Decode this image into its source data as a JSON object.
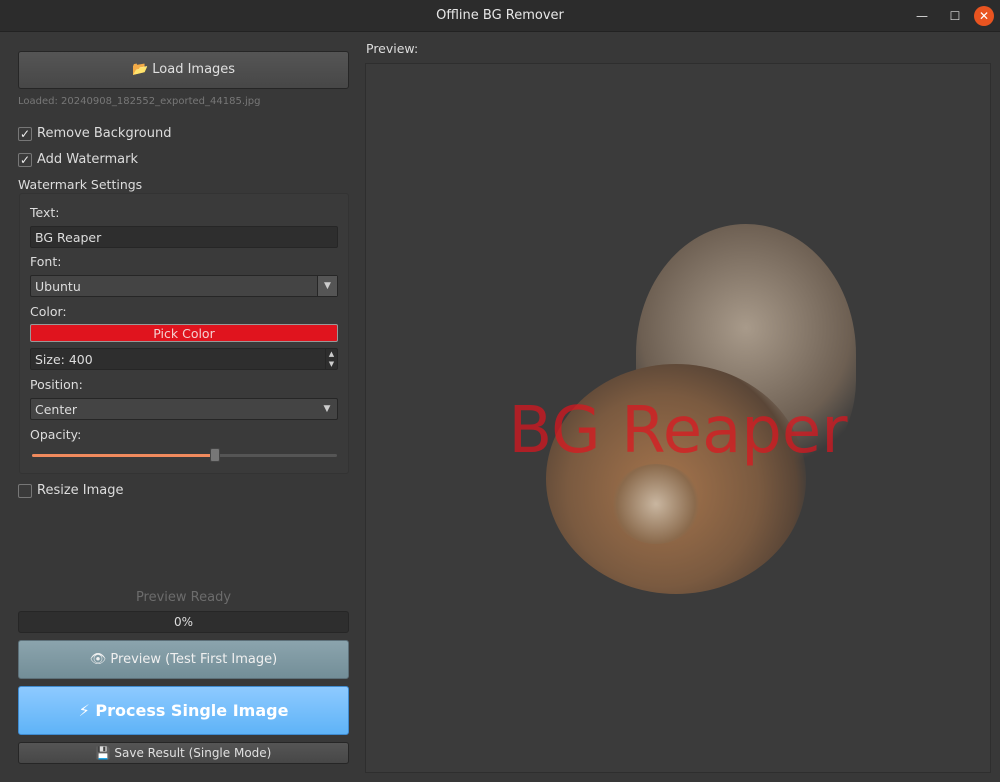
{
  "window": {
    "title": "Offline BG Remover"
  },
  "left": {
    "load_button": "📂 Load Images",
    "loaded_text": "Loaded: 20240908_182552_exported_44185.jpg",
    "remove_bg": {
      "label": "Remove Background",
      "checked": true
    },
    "add_watermark": {
      "label": "Add Watermark",
      "checked": true
    },
    "wm_group_title": "Watermark Settings",
    "text_label": "Text:",
    "text_value": "BG Reaper",
    "font_label": "Font:",
    "font_value": "Ubuntu",
    "color_label": "Color:",
    "color_button": "Pick Color",
    "color_hex": "#e0141e",
    "size_value": "Size: 400",
    "position_label": "Position:",
    "position_value": "Center",
    "opacity_label": "Opacity:",
    "opacity_fraction": 0.6,
    "resize": {
      "label": "Resize Image",
      "checked": false
    },
    "status": "Preview Ready",
    "progress_text": "0%",
    "progress": 0,
    "preview_button": "👁 Preview (Test First Image)",
    "process_button": "⚡ Process Single Image",
    "save_button": "💾 Save Result (Single Mode)"
  },
  "preview": {
    "label": "Preview:",
    "watermark": "BG Reaper"
  }
}
